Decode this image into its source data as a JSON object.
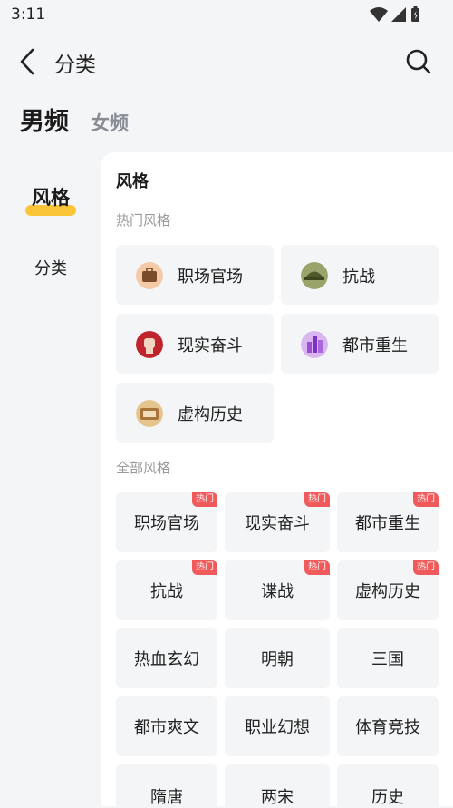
{
  "status": {
    "time": "3:11"
  },
  "header": {
    "title": "分类"
  },
  "gender": {
    "active": "男频",
    "inactive": "女频"
  },
  "nav": {
    "items": [
      {
        "label": "风格"
      },
      {
        "label": "分类"
      }
    ]
  },
  "main": {
    "section_title": "风格",
    "hot_title": "热门风格",
    "hot": [
      {
        "label": "职场官场",
        "icon": "briefcase-icon"
      },
      {
        "label": "抗战",
        "icon": "soldier-helmet-icon"
      },
      {
        "label": "现实奋斗",
        "icon": "fist-icon"
      },
      {
        "label": "都市重生",
        "icon": "city-buildings-icon"
      },
      {
        "label": "虚构历史",
        "icon": "scroll-icon"
      }
    ],
    "all_title": "全部风格",
    "badge": "热门",
    "all": [
      {
        "label": "职场官场",
        "hot": true
      },
      {
        "label": "现实奋斗",
        "hot": true
      },
      {
        "label": "都市重生",
        "hot": true
      },
      {
        "label": "抗战",
        "hot": true
      },
      {
        "label": "谍战",
        "hot": true
      },
      {
        "label": "虚构历史",
        "hot": true
      },
      {
        "label": "热血玄幻",
        "hot": false
      },
      {
        "label": "明朝",
        "hot": false
      },
      {
        "label": "三国",
        "hot": false
      },
      {
        "label": "都市爽文",
        "hot": false
      },
      {
        "label": "职业幻想",
        "hot": false
      },
      {
        "label": "体育竞技",
        "hot": false
      },
      {
        "label": "隋唐",
        "hot": false
      },
      {
        "label": "两宋",
        "hot": false
      },
      {
        "label": "历史",
        "hot": false
      }
    ]
  },
  "colors": {
    "accent": "#fbc53a",
    "badge": "#f05a5a",
    "card": "#f4f5f7"
  }
}
